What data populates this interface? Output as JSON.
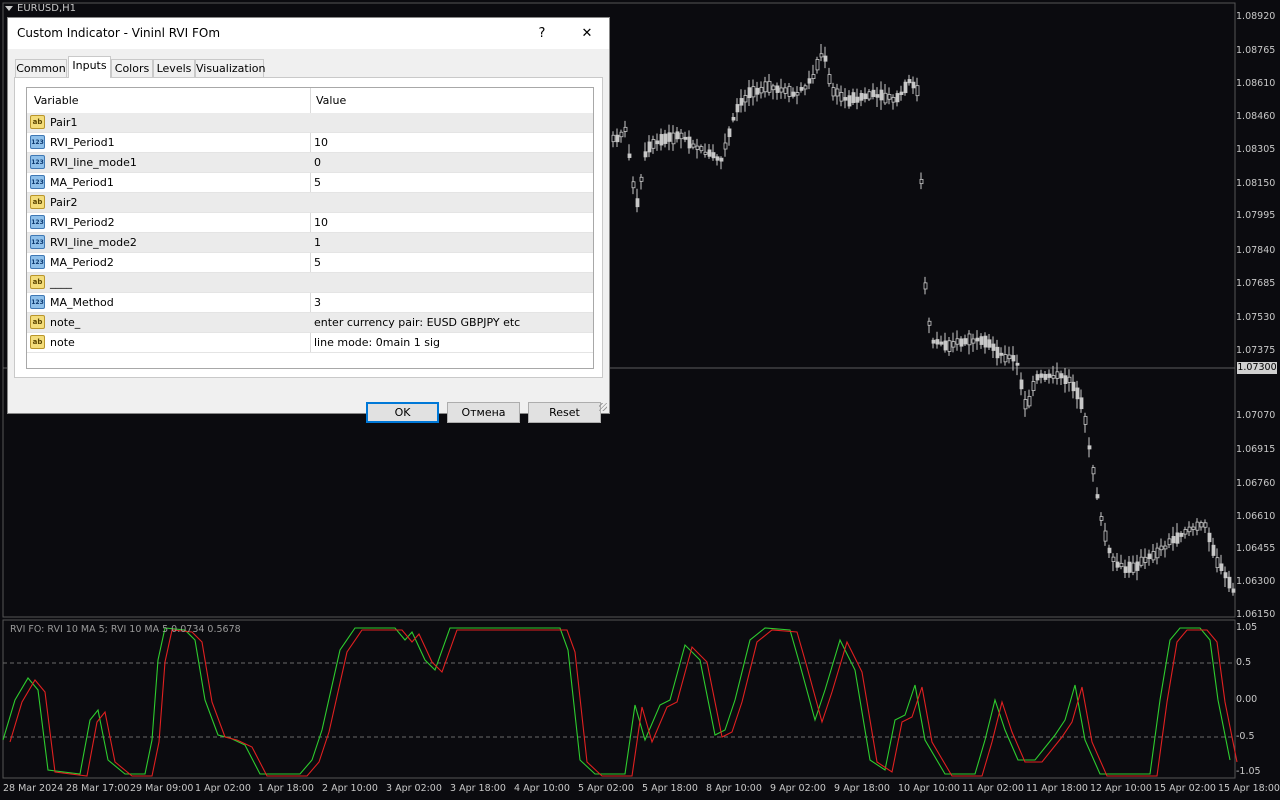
{
  "chart": {
    "symbol_label": "EURUSD,H1",
    "current_price": "1.07300",
    "price_axis": [
      "1.08920",
      "1.08765",
      "1.08610",
      "1.08460",
      "1.08305",
      "1.08150",
      "1.07995",
      "1.07840",
      "1.07685",
      "1.07530",
      "1.07375",
      "1.07070",
      "1.06915",
      "1.06760",
      "1.06610",
      "1.06455",
      "1.06300",
      "1.06150"
    ],
    "indicator_label": "RVI FO:  RVI 10 MA 5;  RVI 10 MA 5  0.0734 0.5678",
    "indicator_axis": [
      "1.05",
      "0.5",
      "0.00",
      "-0.5",
      "-1.05"
    ],
    "time_axis": [
      "28 Mar 2024",
      "28 Mar 17:00",
      "29 Mar 09:00",
      "1 Apr 02:00",
      "1 Apr 18:00",
      "2 Apr 10:00",
      "3 Apr 02:00",
      "3 Apr 18:00",
      "4 Apr 10:00",
      "5 Apr 02:00",
      "5 Apr 18:00",
      "8 Apr 10:00",
      "9 Apr 02:00",
      "9 Apr 18:00",
      "10 Apr 10:00",
      "11 Apr 02:00",
      "11 Apr 18:00",
      "12 Apr 10:00",
      "15 Apr 02:00",
      "15 Apr 18:00"
    ],
    "colors": {
      "bg": "#0b0b0f",
      "candle": "#c8c8c8",
      "rvi_main": "#2ecc2e",
      "rvi_signal": "#e02020",
      "grid_dash": "#6a6a6a"
    }
  },
  "dialog": {
    "title": "Custom Indicator - Vininl RVI FOm",
    "help_label": "?",
    "close_label": "✕",
    "tabs": [
      {
        "label": "Common",
        "active": false
      },
      {
        "label": "Inputs",
        "active": true
      },
      {
        "label": "Colors",
        "active": false
      },
      {
        "label": "Levels",
        "active": false
      },
      {
        "label": "Visualization",
        "active": false
      }
    ],
    "grid": {
      "col_variable": "Variable",
      "col_value": "Value",
      "rows": [
        {
          "type": "str",
          "type_icon": "ab",
          "name": "Pair1",
          "value": ""
        },
        {
          "type": "num",
          "type_icon": "123",
          "name": "RVI_Period1",
          "value": "10"
        },
        {
          "type": "num",
          "type_icon": "123",
          "name": "RVI_line_mode1",
          "value": "0"
        },
        {
          "type": "num",
          "type_icon": "123",
          "name": "MA_Period1",
          "value": "5"
        },
        {
          "type": "str",
          "type_icon": "ab",
          "name": "Pair2",
          "value": ""
        },
        {
          "type": "num",
          "type_icon": "123",
          "name": "RVI_Period2",
          "value": "10"
        },
        {
          "type": "num",
          "type_icon": "123",
          "name": "RVI_line_mode2",
          "value": "1"
        },
        {
          "type": "num",
          "type_icon": "123",
          "name": "MA_Period2",
          "value": "5"
        },
        {
          "type": "str",
          "type_icon": "ab",
          "name": "____",
          "value": ""
        },
        {
          "type": "num",
          "type_icon": "123",
          "name": "MA_Method",
          "value": "3"
        },
        {
          "type": "str",
          "type_icon": "ab",
          "name": "note_",
          "value": "enter currency pair: EUSD GBPJPY etc"
        },
        {
          "type": "str",
          "type_icon": "ab",
          "name": "note",
          "value": "line mode: 0main 1 sig"
        }
      ]
    },
    "buttons": {
      "ok": "OK",
      "cancel": "Отмена",
      "reset": "Reset"
    }
  }
}
